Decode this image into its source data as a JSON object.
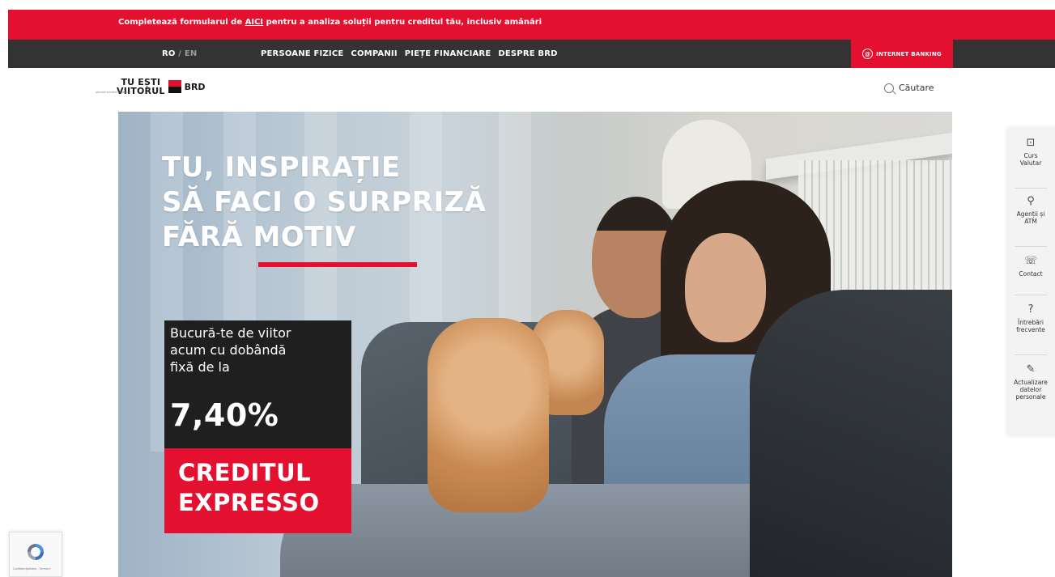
{
  "announcement": {
    "text_before": "Completează formularul de ",
    "link_text": "AICI",
    "text_after": " pentru a analiza soluții pentru creditul tău, inclusiv amânări"
  },
  "topnav": {
    "lang_ro": "RO",
    "lang_sep": " / ",
    "lang_en": "EN",
    "links": [
      "PERSOANE FIZICE",
      "COMPANII",
      "PIEȚE FINANCIARE",
      "DESPRE BRD"
    ],
    "internet_banking": "INTERNET BANKING"
  },
  "header": {
    "logo_line1": "TU EȘTI",
    "logo_line2": "VIITORUL",
    "logo_brand": "BRD",
    "logo_sub": "GROUPE SOCIETE GENERALE",
    "search_label": "Căutare"
  },
  "hero": {
    "headline": [
      "TU, INSPIRAȚIE",
      "SĂ FACI O SURPRIZĂ",
      "FĂRĂ MOTIV"
    ],
    "promo_text": [
      "Bucură-te de viitor",
      "acum cu dobândă",
      "fixă de la"
    ],
    "promo_rate": "7,40%",
    "product": [
      "CREDITUL",
      "EXPRESSO"
    ]
  },
  "quick_links": [
    {
      "label": [
        "Curs",
        "Valutar"
      ],
      "icon": "currency-icon"
    },
    {
      "label": [
        "Agenții și",
        "ATM"
      ],
      "icon": "location-icon"
    },
    {
      "label": [
        "Contact"
      ],
      "icon": "contact-icon"
    },
    {
      "label": [
        "Întrebări",
        "frecvente"
      ],
      "icon": "faq-icon"
    },
    {
      "label": [
        "Actualizare",
        "datelor",
        "personale"
      ],
      "icon": "update-data-icon"
    }
  ],
  "recaptcha": {
    "footer": "Confidențialitate - Termeni"
  },
  "colors": {
    "brand_red": "#e4102f",
    "nav_dark": "#333333",
    "promo_dark": "#1f1f1f"
  }
}
